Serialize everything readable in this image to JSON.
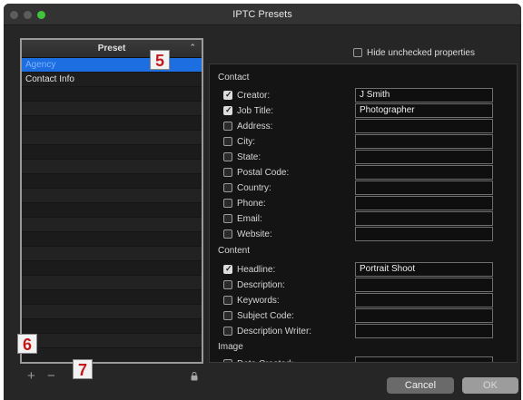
{
  "window": {
    "title": "IPTC Presets"
  },
  "preset_list": {
    "header": "Preset",
    "items": [
      {
        "label": "Agency",
        "selected": true
      },
      {
        "label": "Contact Info",
        "selected": false
      }
    ]
  },
  "hide_unchecked": {
    "label": "Hide unchecked properties",
    "checked": false
  },
  "sections": {
    "contact": "Contact",
    "content": "Content",
    "image": "Image"
  },
  "contact_props": [
    {
      "label": "Creator:",
      "checked": true,
      "value": "J Smith"
    },
    {
      "label": "Job Title:",
      "checked": true,
      "value": "Photographer"
    },
    {
      "label": "Address:",
      "checked": false,
      "value": ""
    },
    {
      "label": "City:",
      "checked": false,
      "value": ""
    },
    {
      "label": "State:",
      "checked": false,
      "value": ""
    },
    {
      "label": "Postal Code:",
      "checked": false,
      "value": ""
    },
    {
      "label": "Country:",
      "checked": false,
      "value": ""
    },
    {
      "label": "Phone:",
      "checked": false,
      "value": ""
    },
    {
      "label": "Email:",
      "checked": false,
      "value": ""
    },
    {
      "label": "Website:",
      "checked": false,
      "value": ""
    }
  ],
  "content_props": [
    {
      "label": "Headline:",
      "checked": true,
      "value": "Portrait Shoot"
    },
    {
      "label": "Description:",
      "checked": false,
      "value": ""
    },
    {
      "label": "Keywords:",
      "checked": false,
      "value": ""
    },
    {
      "label": "Subject Code:",
      "checked": false,
      "value": ""
    },
    {
      "label": "Description Writer:",
      "checked": false,
      "value": ""
    }
  ],
  "image_props": [
    {
      "label": "Date Created:",
      "checked": false,
      "value": ""
    }
  ],
  "toolbar": {
    "add_label": "+",
    "remove_label": "−"
  },
  "buttons": {
    "cancel": "Cancel",
    "ok": "OK"
  },
  "callouts": {
    "preset_header": "5",
    "add": "6",
    "remove": "7"
  },
  "colors": {
    "selection": "#1d6ee0",
    "callout_text": "#c11a1a",
    "max_button": "#3fc43a"
  }
}
